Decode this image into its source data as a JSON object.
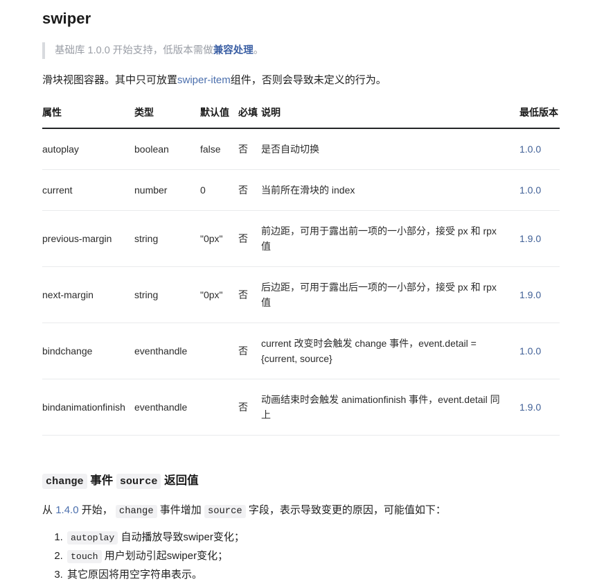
{
  "page": {
    "title": "swiper",
    "notice": {
      "prefix": "基础库 1.0.0 开始支持，低版本需做",
      "link": "兼容处理",
      "suffix": "。"
    },
    "intro": {
      "before": "滑块视图容器。其中只可放置",
      "link": "swiper-item",
      "after": "组件，否则会导致未定义的行为。"
    }
  },
  "table": {
    "headers": {
      "attribute": "属性",
      "type": "类型",
      "default": "默认值",
      "required": "必填",
      "description": "说明",
      "min_version": "最低版本"
    },
    "rows": [
      {
        "attribute": "autoplay",
        "type": "boolean",
        "default": "false",
        "required": "否",
        "description": "是否自动切换",
        "min_version": "1.0.0"
      },
      {
        "attribute": "current",
        "type": "number",
        "default": "0",
        "required": "否",
        "description": "当前所在滑块的 index",
        "min_version": "1.0.0"
      },
      {
        "attribute": "previous-margin",
        "type": "string",
        "default": "\"0px\"",
        "required": "否",
        "description": "前边距，可用于露出前一项的一小部分，接受 px 和 rpx 值",
        "min_version": "1.9.0"
      },
      {
        "attribute": "next-margin",
        "type": "string",
        "default": "\"0px\"",
        "required": "否",
        "description": "后边距，可用于露出后一项的一小部分，接受 px 和 rpx 值",
        "min_version": "1.9.0"
      },
      {
        "attribute": "bindchange",
        "type": "eventhandle",
        "default": "",
        "required": "否",
        "description": "current 改变时会触发 change 事件，event.detail = {current, source}",
        "min_version": "1.0.0"
      },
      {
        "attribute": "bindanimationfinish",
        "type": "eventhandle",
        "default": "",
        "required": "否",
        "description": "动画结束时会触发 animationfinish 事件，event.detail 同上",
        "min_version": "1.9.0"
      }
    ]
  },
  "section": {
    "heading": {
      "code1": "change",
      "mid1": "事件",
      "code2": "source",
      "tail": "返回值"
    },
    "paragraph": {
      "p1": "从",
      "version": "1.4.0",
      "p2": "开始，",
      "code1": "change",
      "p3": "事件增加",
      "code2": "source",
      "p4": "字段，表示导致变更的原因，可能值如下："
    },
    "list": [
      {
        "code": "autoplay",
        "text": "自动播放导致swiper变化；"
      },
      {
        "code": "touch",
        "text": "用户划动引起swiper变化；"
      },
      {
        "code": "",
        "text": "其它原因将用空字符串表示。"
      }
    ]
  }
}
